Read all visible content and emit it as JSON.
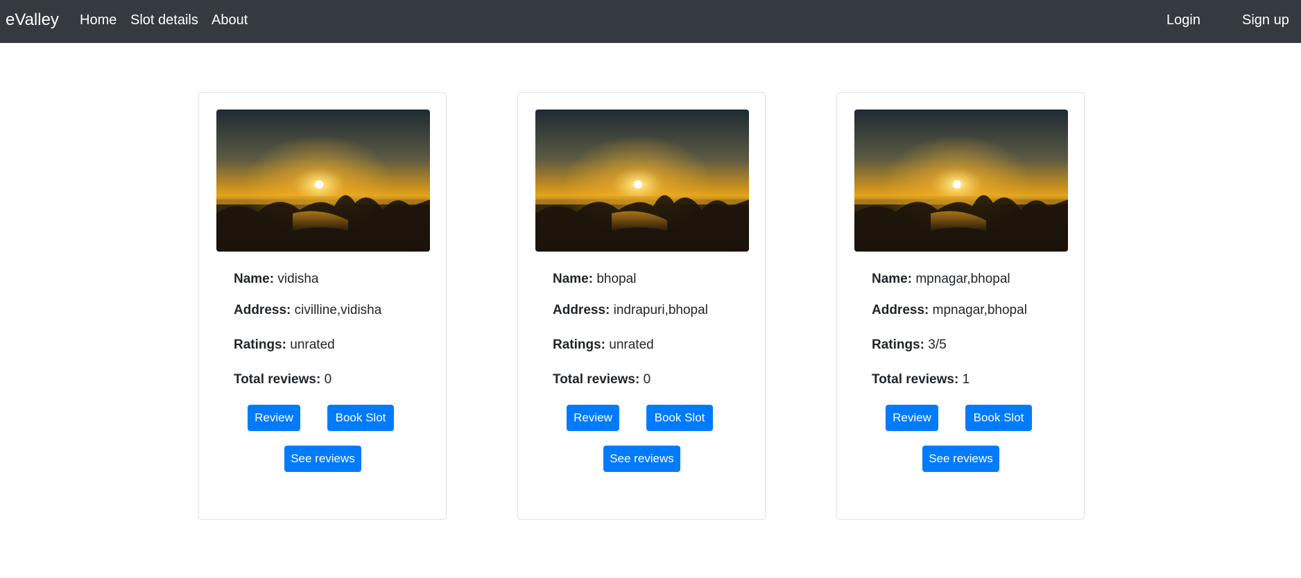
{
  "navbar": {
    "brand": "eValley",
    "links": [
      {
        "label": "Home"
      },
      {
        "label": "Slot details"
      },
      {
        "label": "About"
      }
    ],
    "login_label": "Login",
    "signup_label": "Sign up",
    "background": "#343a40"
  },
  "labels": {
    "name": "Name:",
    "address": "Address:",
    "ratings": "Ratings:",
    "total_reviews": "Total reviews:"
  },
  "buttons": {
    "review": "Review",
    "book_slot": "Book Slot",
    "see_reviews": "See reviews",
    "color": "#007bff"
  },
  "cards": [
    {
      "name": "vidisha",
      "address": "civilline,vidisha",
      "ratings": "unrated",
      "total_reviews": "0",
      "image_icon": "sunset-beach-photo"
    },
    {
      "name": "bhopal",
      "address": "indrapuri,bhopal",
      "ratings": "unrated",
      "total_reviews": "0",
      "image_icon": "sunset-beach-photo"
    },
    {
      "name": "mpnagar,bhopal",
      "address": "mpnagar,bhopal",
      "ratings": "3/5",
      "total_reviews": "1",
      "image_icon": "sunset-beach-photo"
    }
  ]
}
